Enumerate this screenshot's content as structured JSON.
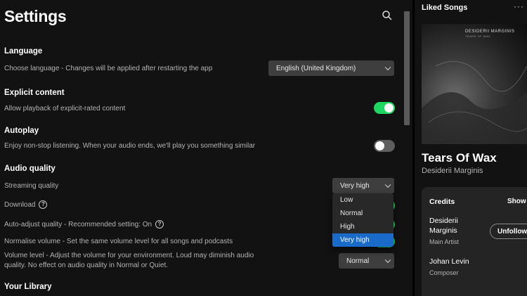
{
  "settings": {
    "title": "Settings",
    "language": {
      "heading": "Language",
      "description": "Choose language - Changes will be applied after restarting the app",
      "value": "English (United Kingdom)"
    },
    "explicit": {
      "heading": "Explicit content",
      "description": "Allow playback of explicit-rated content",
      "enabled": true
    },
    "autoplay": {
      "heading": "Autoplay",
      "description": "Enjoy non-stop listening. When your audio ends, we'll play you something similar",
      "enabled": false
    },
    "audio_quality": {
      "heading": "Audio quality",
      "streaming_label": "Streaming quality",
      "streaming_value": "Very high",
      "streaming_options": [
        "Low",
        "Normal",
        "High",
        "Very high"
      ],
      "download_label": "Download",
      "auto_adjust_label": "Auto-adjust quality - Recommended setting: On",
      "normalise_label": "Normalise volume - Set the same volume level for all songs and podcasts",
      "volume_level_label": "Volume level - Adjust the volume for your environment. Loud may diminish audio quality. No effect on audio quality in Normal or Quiet.",
      "volume_level_value": "Normal"
    },
    "library": {
      "heading": "Your Library"
    }
  },
  "right_panel": {
    "title": "Liked Songs",
    "more": "···",
    "cover_text": "DESIDERII MARGINIS",
    "cover_subtext": "TEARS OF WAX",
    "song": "Tears Of Wax",
    "artist": "Desiderii Marginis",
    "credits": {
      "title": "Credits",
      "show_all": "Show",
      "people": [
        {
          "name": "Desiderii Marginis",
          "role": "Main Artist",
          "action": "Unfollow"
        },
        {
          "name": "Johan Levin",
          "role": "Composer"
        }
      ]
    }
  },
  "colors": {
    "accent": "#1ed760",
    "selected": "#1a6bc9"
  }
}
